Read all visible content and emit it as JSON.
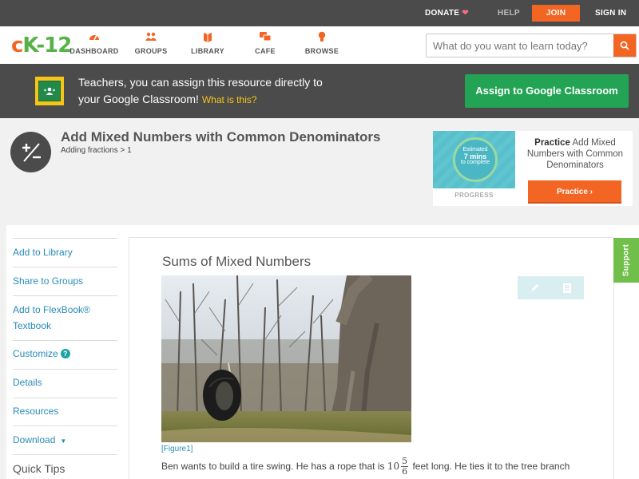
{
  "topbar": {
    "donate": "DONATE",
    "help": "HELP",
    "join": "JOIN",
    "signin": "SIGN IN"
  },
  "nav": {
    "logo": {
      "c": "c",
      "k": "K",
      "dash": "-",
      "num": "12"
    },
    "items": [
      {
        "label": "DASHBOARD",
        "icon": "dashboard-icon"
      },
      {
        "label": "GROUPS",
        "icon": "groups-icon"
      },
      {
        "label": "LIBRARY",
        "icon": "library-icon"
      },
      {
        "label": "CAFE",
        "icon": "cafe-icon"
      },
      {
        "label": "BROWSE",
        "icon": "browse-icon"
      }
    ],
    "search_placeholder": "What do you want to learn today?"
  },
  "banner": {
    "line1": "Teachers, you can assign this resource directly to",
    "line2": "your Google Classroom!",
    "what": "What is this?",
    "button": "Assign to Google Classroom"
  },
  "lesson": {
    "title": "Add Mixed Numbers with Common Denominators",
    "breadcrumb": "Adding fractions > 1"
  },
  "practice": {
    "ring_top": "Estimated",
    "ring_mid": "7 mins",
    "ring_bot": "to complete",
    "progress": "PROGRESS",
    "bold": "Practice",
    "title": "Add Mixed Numbers with Common Denominators",
    "button": "Practice"
  },
  "sidebar": {
    "items": [
      "Add to Library",
      "Share to Groups",
      "Add to FlexBook® Textbook",
      "Customize",
      "Details",
      "Resources",
      "Download"
    ],
    "flexbook_1": "Add to FlexBook®",
    "flexbook_2": "Textbook",
    "quick_tips": "Quick Tips"
  },
  "content": {
    "title": "Sums of Mixed Numbers",
    "figure_caption": "[Figure1]",
    "para_start": "Ben wants to build a tire swing. He has a rope that is",
    "whole": "10",
    "num": "5",
    "den": "6",
    "para_end": "feet long. He ties it to the tree branch"
  },
  "support": "Support",
  "colors": {
    "accent": "#f26522",
    "green": "#23a455",
    "link": "#2a8bb8",
    "dark_bar": "#4b4b4b"
  }
}
